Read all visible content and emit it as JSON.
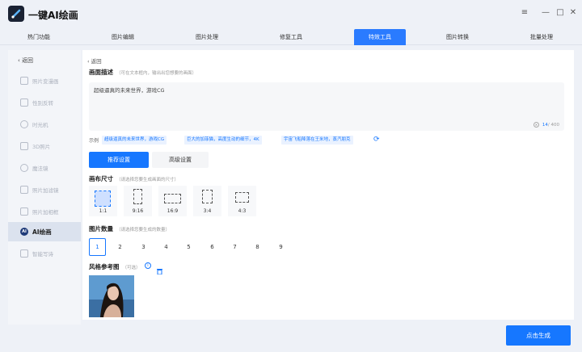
{
  "app": {
    "title": "一键AI绘画",
    "accent": "#1677ff"
  },
  "window_controls": {
    "menu": "≡",
    "minimize": "—",
    "maximize": "□",
    "close": "✕"
  },
  "tabs": [
    {
      "label": "热门功能",
      "active": false
    },
    {
      "label": "图片编辑",
      "active": false
    },
    {
      "label": "图片处理",
      "active": false
    },
    {
      "label": "修复工具",
      "active": false
    },
    {
      "label": "特效工具",
      "active": true
    },
    {
      "label": "图片转换",
      "active": false
    },
    {
      "label": "批量处理",
      "active": false
    }
  ],
  "sidebar": {
    "back": "返回",
    "items": [
      {
        "label": "照片变漫画",
        "icon": "cartoon-icon"
      },
      {
        "label": "性别反转",
        "icon": "gender-icon"
      },
      {
        "label": "时光机",
        "icon": "clock-icon"
      },
      {
        "label": "3D照片",
        "icon": "cube-icon"
      },
      {
        "label": "魔法镜",
        "icon": "mirror-icon"
      },
      {
        "label": "照片加滤镜",
        "icon": "filter-icon"
      },
      {
        "label": "照片加相框",
        "icon": "frame-icon"
      },
      {
        "label": "AI绘画",
        "icon": "ai-icon",
        "active": true
      },
      {
        "label": "智能写诗",
        "icon": "poem-icon"
      }
    ]
  },
  "main": {
    "back": "返回",
    "prompt": {
      "label": "画面描述",
      "hint": "（可在文本框内，输出出您想要的画面）",
      "text": "超级逼真的未来世界，游戏CG",
      "count": "14",
      "max": "/ 400"
    },
    "examples": {
      "label": "示例",
      "items": [
        "超级逼真的未来世界，游戏CG",
        "巨大的加菲猫，高度生动的细节，4K",
        "宇宙飞船降落在王米地，蒸汽朋克"
      ]
    },
    "modes": [
      "推荐设置",
      "高级设置"
    ],
    "canvas": {
      "label": "画布尺寸",
      "hint": "（请选择您要生成画面的尺寸）",
      "ratios": [
        "1:1",
        "9:16",
        "16:9",
        "3:4",
        "4:3"
      ]
    },
    "count": {
      "label": "图片数量",
      "hint": "（请选择您要生成的数量）",
      "options": [
        "1",
        "2",
        "3",
        "4",
        "5",
        "6",
        "7",
        "8",
        "9"
      ]
    },
    "reference": {
      "label": "风格参考图",
      "hint": "（可选）"
    }
  },
  "generate_button": "点击生成"
}
